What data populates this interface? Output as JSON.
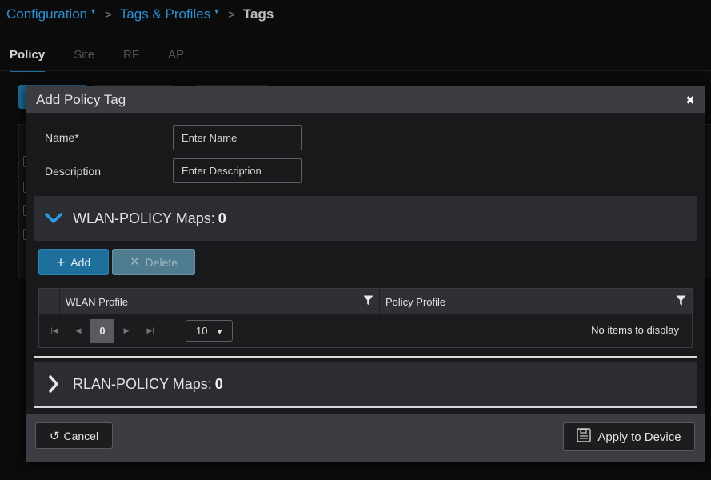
{
  "breadcrumb": {
    "items": [
      {
        "label": "Configuration"
      },
      {
        "label": "Tags & Profiles"
      },
      {
        "label": "Tags"
      }
    ]
  },
  "page_tabs": [
    "Policy",
    "Site",
    "RF",
    "AP"
  ],
  "modal": {
    "title": "Add Policy Tag",
    "close_icon": "close-icon",
    "name": {
      "label": "Name*",
      "placeholder": "Enter Name",
      "value": ""
    },
    "description": {
      "label": "Description",
      "placeholder": "Enter Description",
      "value": ""
    },
    "wlan_section": {
      "title": "WLAN-POLICY Maps:",
      "count": "0",
      "expanded": true
    },
    "add_label": "Add",
    "delete_label": "Delete",
    "grid": {
      "columns": [
        "WLAN Profile",
        "Policy Profile"
      ],
      "page": "0",
      "page_size": "10",
      "empty_text": "No items to display"
    },
    "rlan_section": {
      "title": "RLAN-POLICY Maps:",
      "count": "0",
      "expanded": false
    },
    "cancel_label": "Cancel",
    "apply_label": "Apply to Device"
  },
  "colors": {
    "accent": "#1e6f9c",
    "link": "#2f8fd1",
    "header_bg": "#3c3d42"
  }
}
